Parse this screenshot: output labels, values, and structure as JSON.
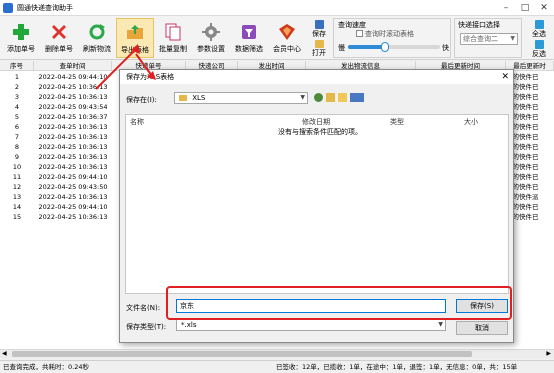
{
  "app": {
    "title": "圆通快递查询助手"
  },
  "window_controls": [
    "–",
    "□",
    "✕"
  ],
  "toolbar": {
    "buttons": [
      {
        "label": "添加单号",
        "icon": "plus-icon",
        "color": "#22a83a"
      },
      {
        "label": "删除单号",
        "icon": "x-icon",
        "color": "#e0312a"
      },
      {
        "label": "刷新物流",
        "icon": "refresh-icon",
        "color": "#2aa84a"
      },
      {
        "label": "导出表格",
        "icon": "export-folder-icon",
        "color": "#e8a53a"
      },
      {
        "label": "批量复制",
        "icon": "copy-icon",
        "color": "#c8336b"
      },
      {
        "label": "参数设置",
        "icon": "gear-icon",
        "color": "#777777"
      },
      {
        "label": "数据筛选",
        "icon": "filter-icon",
        "color": "#8b4bb8"
      },
      {
        "label": "会员中心",
        "icon": "member-icon",
        "color": "#cf3a1a"
      }
    ],
    "save_label": "保存",
    "open_label": "打开",
    "speed_group": {
      "title": "查询速度",
      "checkbox_label": "查询时滚动表格",
      "slow": "慢",
      "fast": "快",
      "speed_fraction": 0.4
    },
    "interface_group": {
      "title": "快递接口选择",
      "selected": "综合查询二"
    },
    "select_all_label": "全选",
    "invert_label": "反选"
  },
  "table": {
    "headers": [
      "序号",
      "查单时间",
      "快递单号",
      "快递公司",
      "发出时间",
      "发出物流信息",
      "最后更新时间",
      "最后更新时"
    ],
    "rows": [
      {
        "n": "1",
        "time": "2022-04-25 09:44:10",
        "tail": "您的快件已"
      },
      {
        "n": "2",
        "time": "2022-04-25 10:36:13",
        "tail": "您的快件已"
      },
      {
        "n": "3",
        "time": "2022-04-25 10:36:13",
        "tail": "您的快件已"
      },
      {
        "n": "4",
        "time": "2022-04-25 09:43:54",
        "tail": "您的快件已"
      },
      {
        "n": "5",
        "time": "2022-04-25 10:36:37",
        "tail": "您的快件已"
      },
      {
        "n": "6",
        "time": "2022-04-25 10:36:13",
        "tail": "您的快件已"
      },
      {
        "n": "7",
        "time": "2022-04-25 10:36:13",
        "tail": "您的快件已"
      },
      {
        "n": "8",
        "time": "2022-04-25 10:36:13",
        "tail": "您的快件已"
      },
      {
        "n": "9",
        "time": "2022-04-25 10:36:13",
        "tail": "您的快件已"
      },
      {
        "n": "10",
        "time": "2022-04-25 10:36:13",
        "tail": "您的快件已"
      },
      {
        "n": "11",
        "time": "2022-04-25 09:44:10",
        "tail": "您的快件已"
      },
      {
        "n": "12",
        "time": "2022-04-25 09:43:50",
        "tail": "您的快件已"
      },
      {
        "n": "13",
        "time": "2022-04-25 10:36:13",
        "tail": "您的快件派"
      },
      {
        "n": "14",
        "time": "2022-04-25 09:44:10",
        "tail": "您的快件已"
      },
      {
        "n": "15",
        "time": "2022-04-25 10:36:13",
        "tail": "您的快件已"
      }
    ]
  },
  "status": {
    "left": "已查询完成，共耗时：0.24秒",
    "right": "已签收：12单，已揽收：1单，在途中：1单，退签：1单，无信息：0单，共：15单"
  },
  "dialog": {
    "title": "保存为XLS表格",
    "save_in_label": "保存在(I):",
    "save_in_value": "XLS",
    "col_name": "名称",
    "col_date": "修改日期",
    "col_type": "类型",
    "col_size": "大小",
    "empty_message": "没有与搜索条件匹配的项。",
    "filename_label": "文件名(N):",
    "filename_value": "京东",
    "filetype_label": "保存类型(T):",
    "filetype_value": "*.xls",
    "save_button": "保存(S)",
    "cancel_button": "取消"
  }
}
